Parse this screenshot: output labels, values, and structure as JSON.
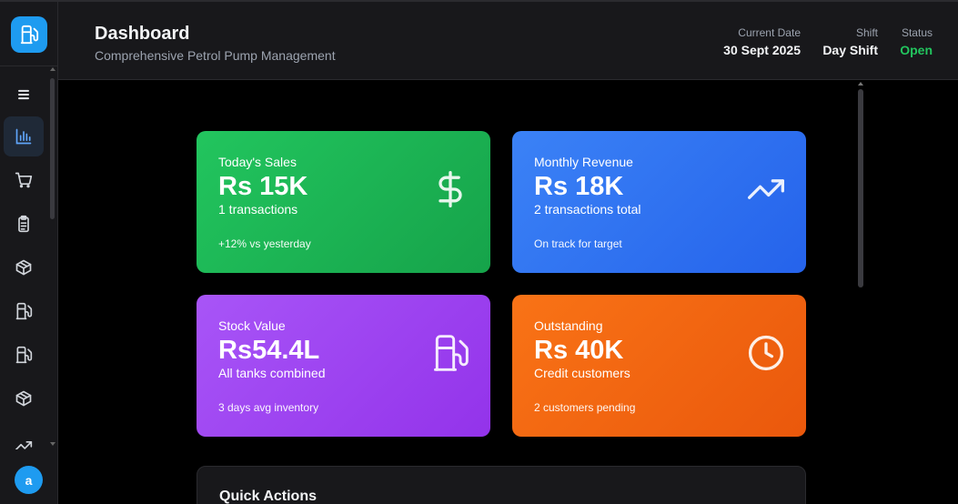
{
  "header": {
    "title": "Dashboard",
    "subtitle": "Comprehensive Petrol Pump Management",
    "date_label": "Current Date",
    "date_value": "30 Sept 2025",
    "shift_label": "Shift",
    "shift_value": "Day Shift",
    "status_label": "Status",
    "status_value": "Open"
  },
  "sidebar": {
    "avatar_letter": "a",
    "items": [
      "menu-icon",
      "chart-icon",
      "cart-icon",
      "clipboard-icon",
      "package-icon",
      "fuel-icon",
      "fuel-icon",
      "package-icon",
      "trend-icon"
    ]
  },
  "cards": [
    {
      "label": "Today's Sales",
      "value": "Rs 15K",
      "sub": "1 transactions",
      "foot": "+12% vs yesterday",
      "icon": "dollar-icon",
      "color": "#22c55e"
    },
    {
      "label": "Monthly Revenue",
      "value": "Rs 18K",
      "sub": "2 transactions total",
      "foot": "On track for target",
      "icon": "trend-up-icon",
      "color": "#3b82f6"
    },
    {
      "label": "Stock Value",
      "value": "Rs54.4L",
      "sub": "All tanks combined",
      "foot": "3 days avg inventory",
      "icon": "fuel-icon",
      "color": "#a855f7"
    },
    {
      "label": "Outstanding",
      "value": "Rs 40K",
      "sub": "Credit customers",
      "foot": "2 customers pending",
      "icon": "clock-icon",
      "color": "#f97316"
    }
  ],
  "quick_actions": {
    "title": "Quick Actions"
  }
}
